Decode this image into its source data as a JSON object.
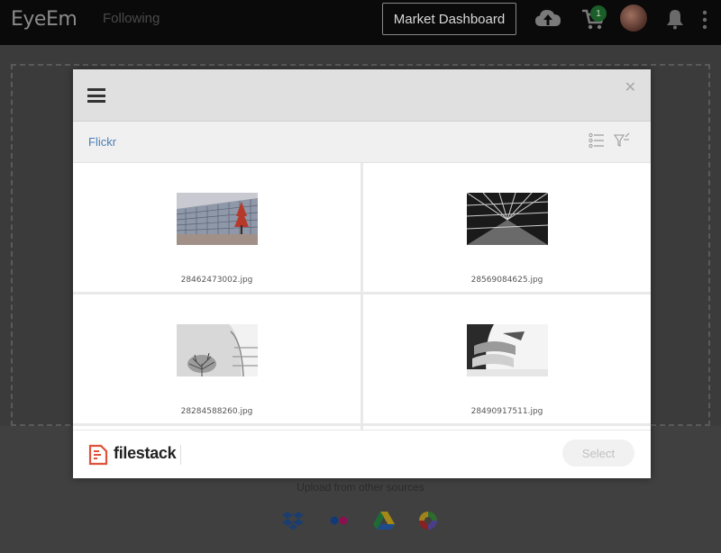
{
  "app": {
    "brand": "EyeEm",
    "nav_following": "Following",
    "market_dashboard": "Market Dashboard",
    "cart_count": "1"
  },
  "page": {
    "upload_other_sources": "Upload from other sources",
    "sources": [
      "dropbox-icon",
      "flickr-icon",
      "google-drive-icon",
      "picasa-icon"
    ]
  },
  "picker": {
    "breadcrumb": "Flickr",
    "files": [
      {
        "name": "28462473002.jpg"
      },
      {
        "name": "28569084625.jpg"
      },
      {
        "name": "28284588260.jpg"
      },
      {
        "name": "28490917511.jpg"
      }
    ],
    "footer": {
      "brand": "filestack",
      "select_label": "Select"
    }
  },
  "colors": {
    "link": "#4a7fb5",
    "filestack_red": "#e0523a",
    "cart_badge": "#1b5e2a"
  }
}
